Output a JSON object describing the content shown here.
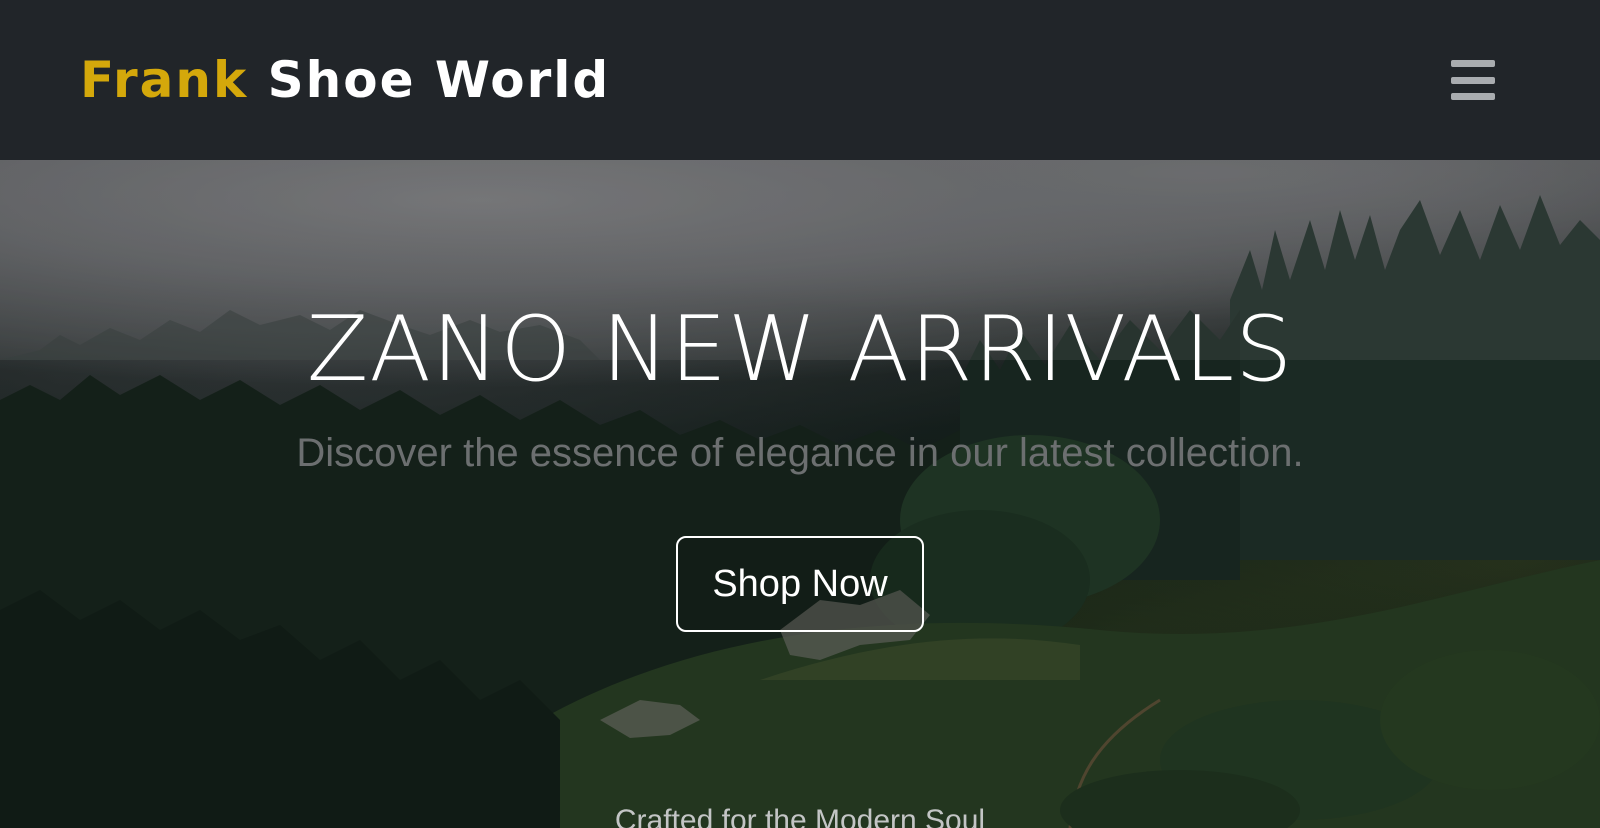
{
  "navbar": {
    "brand_accent": "Frank",
    "brand_rest": "Shoe World",
    "menu_icon": "hamburger-menu-icon",
    "background_color": "#212529",
    "accent_color": "#d4a80b"
  },
  "hero": {
    "title": "ZANO NEW ARRIVALS",
    "subtitle": "Discover the essence of elegance in our latest collection.",
    "button_label": "Shop Now",
    "tagline": "Crafted for the Modern Soul",
    "background_image": "misty-forest-hillside"
  }
}
